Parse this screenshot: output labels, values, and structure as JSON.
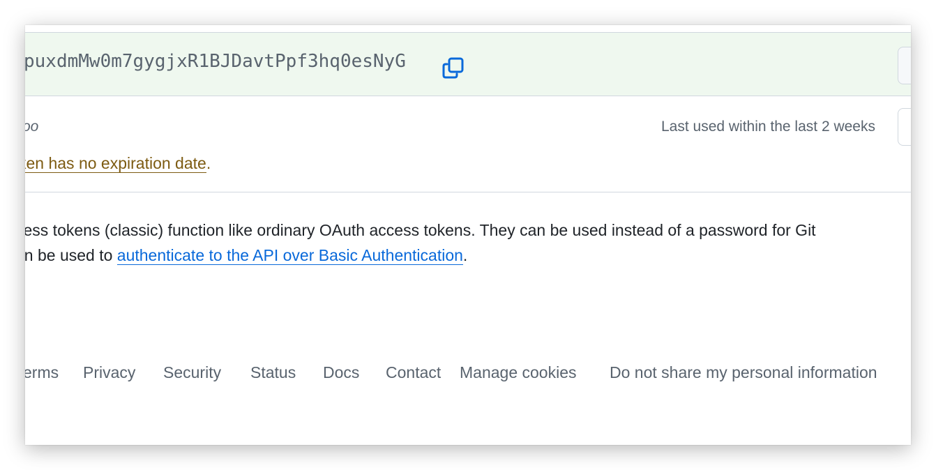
{
  "token": {
    "value": "puxdmMw0m7gygjxR1BJDavtPpf3hq0esNyG",
    "copy_icon": "copy-icon"
  },
  "token_info": {
    "note_partial": "oo",
    "last_used": "Last used within the last 2 weeks",
    "expiry_link_text": "ken has no expiration date",
    "expiry_suffix": "."
  },
  "description": {
    "line1": "cess tokens (classic) function like ordinary OAuth access tokens. They can be used instead of a password for Git",
    "line2_prefix": "an be used to ",
    "line2_link": "authenticate to the API over Basic Authentication",
    "line2_suffix": "."
  },
  "footer": {
    "links": [
      "erms",
      "Privacy",
      "Security",
      "Status",
      "Docs",
      "Contact",
      "Manage cookies",
      "Do not share my personal information"
    ]
  },
  "colors": {
    "token_bg": "#eff8ef",
    "link_blue": "#0969da",
    "attention": "#7d5b12",
    "muted": "#59636e",
    "border": "#d0d7de"
  }
}
